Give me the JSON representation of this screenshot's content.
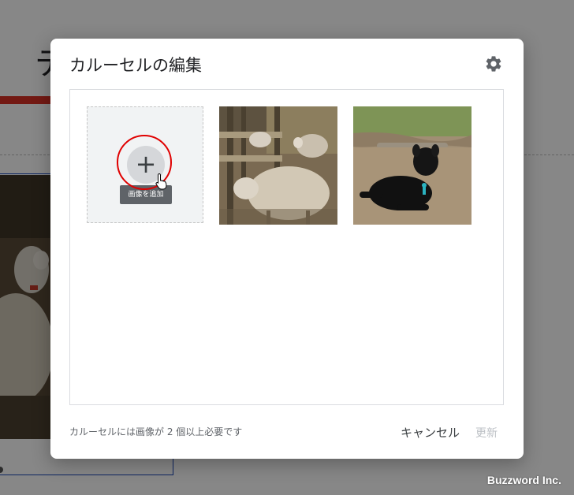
{
  "background": {
    "title_fragment": "テ"
  },
  "dialog": {
    "title": "カルーセルの編集",
    "settings_icon": "gear-icon",
    "add_image": {
      "icon": "plus-icon",
      "symbol": "+",
      "tooltip": "画像を追加"
    },
    "images": [
      {
        "subject": "sheep-in-pen"
      },
      {
        "subject": "black-lamb-lying"
      }
    ],
    "footer_note": "カルーセルには画像が 2 個以上必要です",
    "cancel_label": "キャンセル",
    "update_label": "更新"
  },
  "watermark": "Buzzword Inc.",
  "colors": {
    "highlight_ring": "#e00000",
    "update_disabled": "#bdc1c6",
    "accent_red_bar": "#d93025",
    "frame_blue": "#1a47b8"
  }
}
